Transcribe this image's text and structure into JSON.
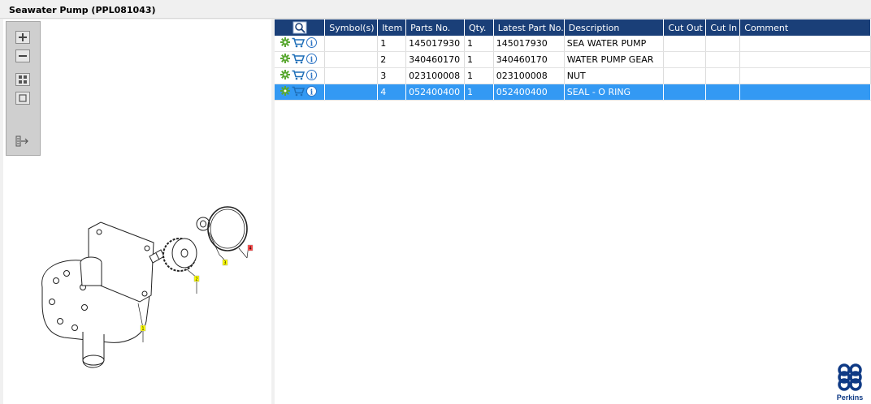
{
  "window": {
    "title": "Seawater Pump (PPL081043)"
  },
  "toolbar": {
    "buttons": [
      {
        "name": "zoom-in",
        "icon": "zoom-in-icon"
      },
      {
        "name": "zoom-out",
        "icon": "zoom-out-icon"
      },
      {
        "name": "fit-page",
        "icon": "grid-icon"
      },
      {
        "name": "actual-size",
        "icon": "frame-icon"
      },
      {
        "name": "export",
        "icon": "export-icon"
      }
    ]
  },
  "drawing": {
    "callouts": [
      {
        "label": "1",
        "color": "#ffff00"
      },
      {
        "label": "2",
        "color": "#ffff00"
      },
      {
        "label": "3",
        "color": "#ffff00"
      },
      {
        "label": "4",
        "color": "#ff3333"
      }
    ]
  },
  "table": {
    "columns": [
      "Symbol(s)",
      "Item",
      "Parts No.",
      "Qty.",
      "Latest Part No.",
      "Description",
      "Cut Out",
      "Cut In",
      "Comment"
    ],
    "rows": [
      {
        "item": "1",
        "parts_no": "145017930",
        "qty": "1",
        "latest": "145017930",
        "description": "SEA WATER PUMP",
        "selected": false
      },
      {
        "item": "2",
        "parts_no": "340460170",
        "qty": "1",
        "latest": "340460170",
        "description": "WATER PUMP GEAR",
        "selected": false
      },
      {
        "item": "3",
        "parts_no": "023100008",
        "qty": "1",
        "latest": "023100008",
        "description": "NUT",
        "selected": false
      },
      {
        "item": "4",
        "parts_no": "052400400",
        "qty": "1",
        "latest": "052400400",
        "description": "SEAL - O RING",
        "selected": true
      }
    ]
  },
  "brand": {
    "name": "Perkins",
    "color": "#0f3a85"
  },
  "colors": {
    "header": "#1a3f78",
    "selected_row": "#3399f3",
    "gear": "#5aa832",
    "cart": "#1f6fb8",
    "info": "#2a72c4"
  }
}
